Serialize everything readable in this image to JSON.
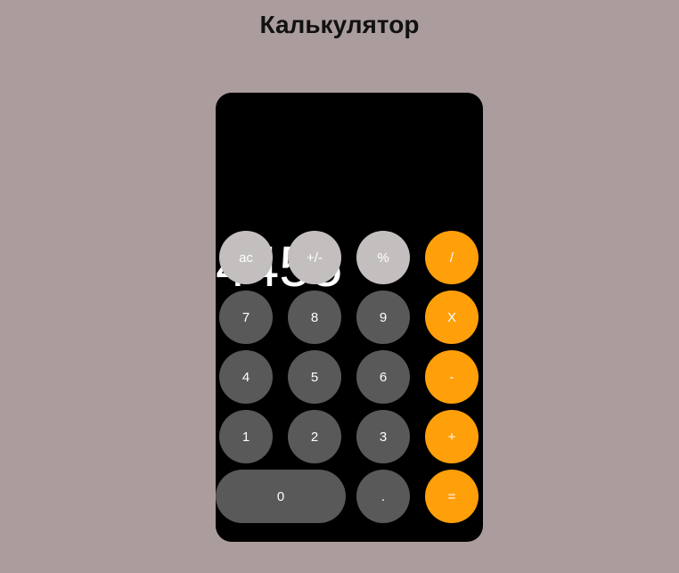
{
  "header": {
    "title": "Калькулятор"
  },
  "display": {
    "value": "4455"
  },
  "keypad": {
    "row1": [
      "ac",
      "+/-",
      "%",
      "/"
    ],
    "row2": [
      "7",
      "8",
      "9",
      "X"
    ],
    "row3": [
      "4",
      "5",
      "6",
      "-"
    ],
    "row4": [
      "1",
      "2",
      "3",
      "+"
    ],
    "row5": [
      "0",
      ".",
      "="
    ]
  },
  "colors": {
    "background": "#ab9d9d",
    "panel": "#000000",
    "function_key": "#c4bfbf",
    "digit_key": "#595959",
    "operator_key": "#ff9f0a",
    "text": "#ffffff"
  }
}
